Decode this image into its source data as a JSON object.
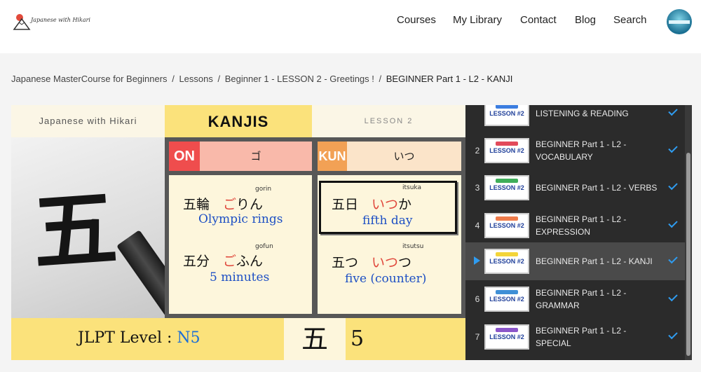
{
  "header": {
    "logo_text": "Japanese with Hikari",
    "nav": [
      "Courses",
      "My Library",
      "Contact",
      "Blog",
      "Search"
    ]
  },
  "breadcrumb": {
    "items": [
      "Japanese MasterCourse for Beginners",
      "Lessons",
      "Beginner 1 - LESSON 2 - Greetings !"
    ],
    "current": "BEGINNER Part 1 - L2 - KANJI",
    "separator": "/"
  },
  "video": {
    "brand": "Japanese with Hikari",
    "title": "KANJIS",
    "lesson": "LESSON 2",
    "kanji": "五",
    "on_label": "ON",
    "on_reading": "ゴ",
    "kun_label": "KUN",
    "kun_reading": "いつ",
    "words": [
      {
        "kanji": "五輪",
        "kana_red": "ご",
        "kana_rest": "りん",
        "romaji": "gorin",
        "meaning": "Olympic rings"
      },
      {
        "kanji": "五分",
        "kana_red": "ご",
        "kana_rest": "ふん",
        "romaji": "gofun",
        "meaning": "5 minutes"
      },
      {
        "kanji": "五日",
        "kana_red": "いつ",
        "kana_rest": "か",
        "romaji": "itsuka",
        "meaning": "fifth day"
      },
      {
        "kanji": "五つ",
        "kana_red": "いつ",
        "kana_rest": "つ",
        "romaji": "itsutsu",
        "meaning": "five (counter)"
      }
    ],
    "jlpt_label": "JLPT Level : ",
    "jlpt_level": "N5",
    "strokes": "5"
  },
  "playlist": {
    "items": [
      {
        "num": "",
        "thumb": "LESSON #2",
        "title": "LISTENING & READING",
        "color": "#3b7de0"
      },
      {
        "num": "2",
        "thumb": "LESSON #2",
        "title": "BEGINNER Part 1 - L2 - VOCABULARY",
        "color": "#e24a5b"
      },
      {
        "num": "3",
        "thumb": "LESSON #2",
        "title": "BEGINNER Part 1 - L2 - VERBS",
        "color": "#3fae5a"
      },
      {
        "num": "4",
        "thumb": "LESSON #2",
        "title": "BEGINNER Part 1 - L2 - EXPRESSION",
        "color": "#ef7b4a"
      },
      {
        "num": "",
        "thumb": "LESSON #2",
        "title": "BEGINNER Part 1 - L2 - KANJI",
        "color": "#f3d43a"
      },
      {
        "num": "6",
        "thumb": "LESSON #2",
        "title": "BEGINNER Part 1 - L2 - GRAMMAR",
        "color": "#3f8fd6"
      },
      {
        "num": "7",
        "thumb": "LESSON #2",
        "title": "BEGINNER Part 1 - L2 - SPECIAL",
        "color": "#8a55c9"
      }
    ],
    "accent": "#2f9cf0"
  }
}
